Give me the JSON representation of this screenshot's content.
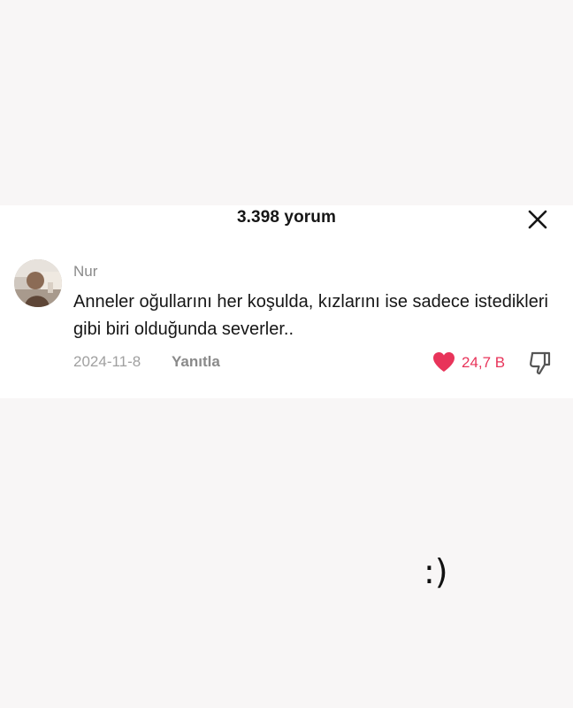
{
  "header": {
    "comment_count": "3.398 yorum",
    "close_icon": "close-icon"
  },
  "comment": {
    "username": "Nur",
    "text": "Anneler oğullarını her koşulda, kızlarını ise sadece istedikleri gibi biri olduğunda severler..",
    "date": "2024-11-8",
    "reply_label": "Yanıtla",
    "like_count": "24,7 B",
    "like_icon": "heart-icon",
    "dislike_icon": "thumbs-down-icon"
  },
  "overlay": {
    "smiley": ":)"
  },
  "colors": {
    "like_accent": "#e8345a",
    "text_primary": "#161616",
    "text_secondary": "#8a8a8a"
  }
}
